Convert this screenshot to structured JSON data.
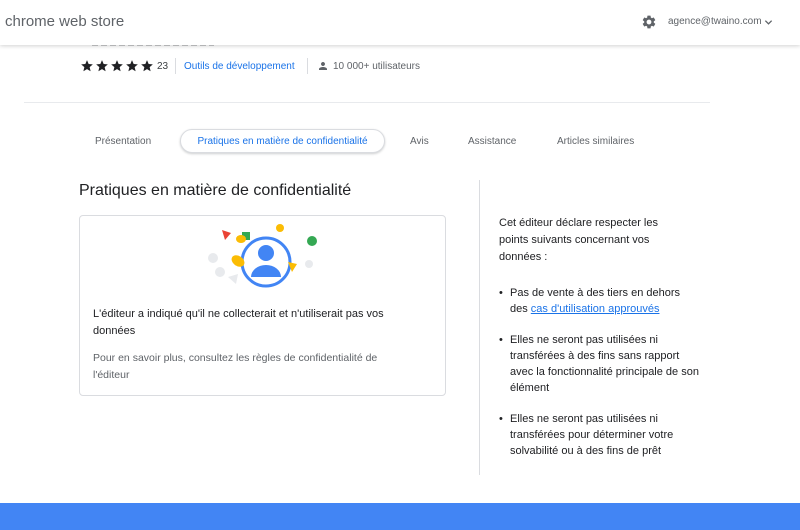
{
  "header": {
    "brand": "chrome web store",
    "account": "agence@twaino.com",
    "icons": {
      "settings": "gear-icon",
      "account_menu": "chevron-down-icon"
    }
  },
  "listing": {
    "rating_count": "23",
    "rating_stars": 5,
    "category": "Outils de développement",
    "users": "10 000+ utilisateurs"
  },
  "tabs": [
    {
      "label": "Présentation",
      "active": false
    },
    {
      "label": "Pratiques en matière de confidentialité",
      "active": true
    },
    {
      "label": "Avis",
      "active": false
    },
    {
      "label": "Assistance",
      "active": false
    },
    {
      "label": "Articles similaires",
      "active": false
    }
  ],
  "privacy": {
    "title": "Pratiques en matière de confidentialité",
    "card_main": "L'éditeur a indiqué qu'il ne collecterait et n'utiliserait pas vos données",
    "card_secondary": "Pour en savoir plus, consultez les règles de confidentialité de l'éditeur",
    "intro": "Cet éditeur déclare respecter les points suivants concernant vos données :",
    "bullet1_text": "Pas de vente à des tiers en dehors des ",
    "bullet1_link": "cas d'utilisation approuvés",
    "bullet2": "Elles ne seront pas utilisées ni transférées à des fins sans rapport avec la fonctionnalité principale de son élément",
    "bullet3": "Elles ne seront pas utilisées ni transférées pour déterminer votre solvabilité ou à des fins de prêt"
  },
  "colors": {
    "accent": "#1a73e8",
    "footer": "#4285f4",
    "illus_blue": "#4285f4",
    "illus_red": "#ea4335",
    "illus_yellow": "#fbbc04",
    "illus_green": "#34a853"
  }
}
